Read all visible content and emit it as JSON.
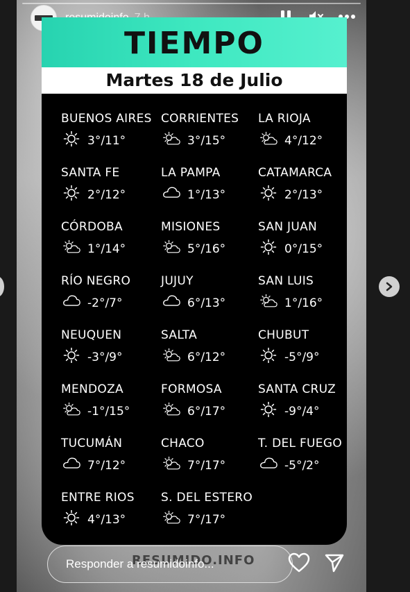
{
  "story": {
    "username": "resumidoinfo",
    "time": "7 h"
  },
  "card": {
    "title": "TIEMPO",
    "date": "Martes 18 de Julio",
    "watermark": "RESUMIDO.INFO"
  },
  "cities": [
    {
      "name": "BUENOS AIRES",
      "temp": "3°/11°",
      "icon": "sun"
    },
    {
      "name": "CORRIENTES",
      "temp": "3°/15°",
      "icon": "sun-cloud"
    },
    {
      "name": "LA RIOJA",
      "temp": "4°/12°",
      "icon": "sun-cloud"
    },
    {
      "name": "SANTA FE",
      "temp": "2°/12°",
      "icon": "sun"
    },
    {
      "name": "LA PAMPA",
      "temp": "1°/13°",
      "icon": "cloud"
    },
    {
      "name": "CATAMARCA",
      "temp": "2°/13°",
      "icon": "sun"
    },
    {
      "name": "CÓRDOBA",
      "temp": "1°/14°",
      "icon": "sun-cloud"
    },
    {
      "name": "MISIONES",
      "temp": "5°/16°",
      "icon": "sun-cloud"
    },
    {
      "name": "SAN JUAN",
      "temp": "0°/15°",
      "icon": "sun"
    },
    {
      "name": "RÍO NEGRO",
      "temp": "-2°/7°",
      "icon": "cloud"
    },
    {
      "name": "JUJUY",
      "temp": "6°/13°",
      "icon": "cloud"
    },
    {
      "name": "SAN LUIS",
      "temp": "1°/16°",
      "icon": "sun-cloud"
    },
    {
      "name": "NEUQUEN",
      "temp": "-3°/9°",
      "icon": "sun"
    },
    {
      "name": "SALTA",
      "temp": "6°/12°",
      "icon": "sun-cloud"
    },
    {
      "name": "CHUBUT",
      "temp": "-5°/9°",
      "icon": "sun"
    },
    {
      "name": "MENDOZA",
      "temp": "-1°/15°",
      "icon": "sun-cloud"
    },
    {
      "name": "FORMOSA",
      "temp": "6°/17°",
      "icon": "sun-cloud"
    },
    {
      "name": "SANTA CRUZ",
      "temp": "-9°/4°",
      "icon": "sun"
    },
    {
      "name": "TUCUMÁN",
      "temp": "7°/12°",
      "icon": "cloud"
    },
    {
      "name": "CHACO",
      "temp": "7°/17°",
      "icon": "sun-cloud"
    },
    {
      "name": "T. DEL FUEGO",
      "temp": "-5°/2°",
      "icon": "cloud"
    },
    {
      "name": "ENTRE RIOS",
      "temp": "4°/13°",
      "icon": "sun"
    },
    {
      "name": "S. DEL ESTERO",
      "temp": "7°/17°",
      "icon": "sun-cloud"
    }
  ],
  "reply": {
    "placeholder": "Responder a resumidoinfo..."
  },
  "icons": {
    "pause": "pause-icon",
    "mute": "volume-muted-icon",
    "more": "more-icon",
    "like": "heart-icon",
    "send": "send-icon",
    "next": "chevron-right-icon"
  }
}
